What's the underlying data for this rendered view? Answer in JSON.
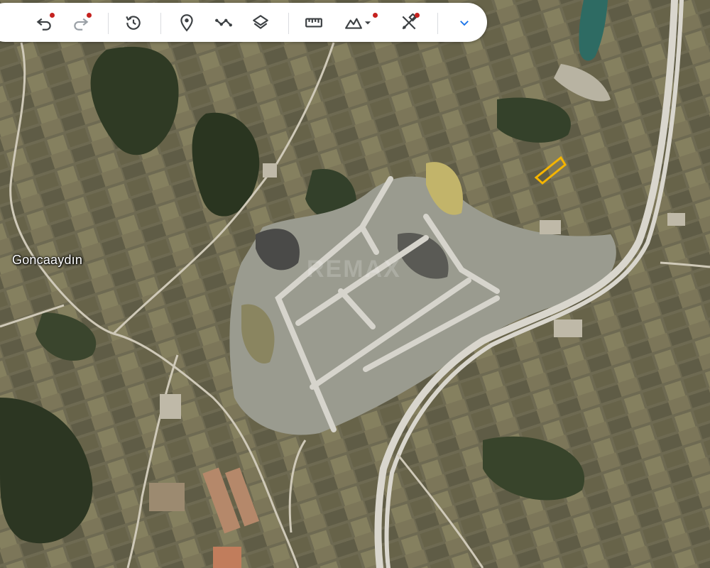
{
  "map": {
    "place_label": "Goncaaydın",
    "watermark": "REMAX"
  },
  "toolbar": {
    "buttons": [
      {
        "icon": "undo-icon",
        "has_badge": true
      },
      {
        "icon": "redo-icon",
        "has_badge": true
      },
      {
        "icon": "historical-imagery-icon",
        "has_badge": false
      },
      {
        "icon": "add-placemark-icon",
        "has_badge": false
      },
      {
        "icon": "add-path-icon",
        "has_badge": false
      },
      {
        "icon": "layers-icon",
        "has_badge": false
      },
      {
        "icon": "ruler-icon",
        "has_badge": true
      },
      {
        "icon": "elevation-profile-icon",
        "has_badge": true
      },
      {
        "icon": "tools-icon",
        "has_badge": true
      },
      {
        "icon": "expand-chevron-icon",
        "has_badge": false
      }
    ]
  },
  "colors": {
    "badge": "#c5221f",
    "icon": "#3c4043",
    "icon_disabled": "#9aa0a6",
    "chevron": "#1a73e8",
    "highlight_polygon": "#f4b400"
  }
}
